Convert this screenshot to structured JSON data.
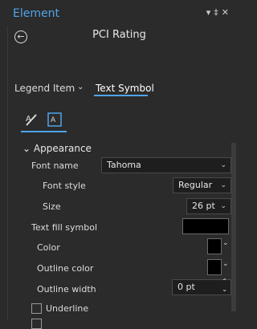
{
  "pane": {
    "title": "Element",
    "header_icons": "▾ ‹ ✕"
  },
  "subtitle": "PCI Rating",
  "tabs": [
    {
      "label": "Legend Item"
    },
    {
      "label": "Text Symbol"
    }
  ],
  "section": {
    "label": "Appearance"
  },
  "fields": {
    "font_name": {
      "label": "Font name",
      "value": "Tahoma"
    },
    "font_style": {
      "label": "Font style",
      "value": "Regular"
    },
    "size": {
      "label": "Size",
      "value": "26 pt"
    },
    "text_fill": {
      "label": "Text fill symbol"
    },
    "color": {
      "label": "Color"
    },
    "outline_color": {
      "label": "Outline color"
    },
    "outline_width": {
      "label": "Outline width",
      "value": "0 pt"
    },
    "underline": {
      "label": "Underline"
    }
  },
  "colors": {
    "accent": "#4fa4ea",
    "swatch": "#000000"
  }
}
